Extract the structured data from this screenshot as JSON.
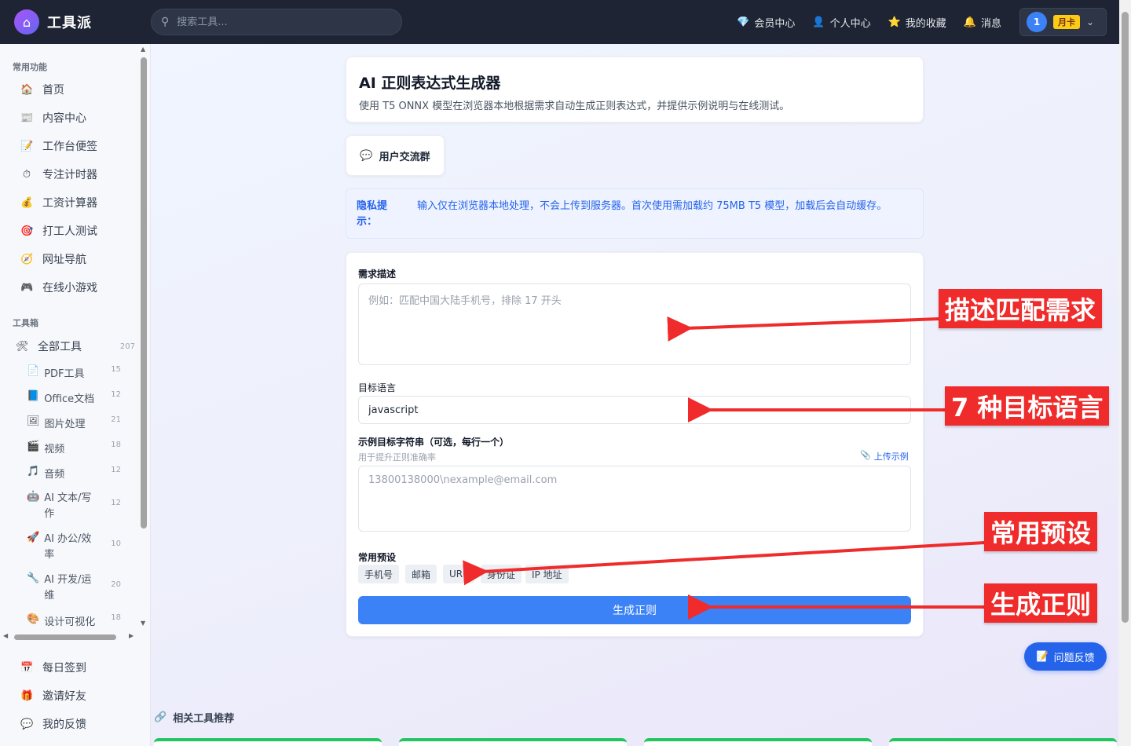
{
  "header": {
    "brand": "工具派",
    "search_placeholder": "搜索工具...",
    "nav": [
      {
        "icon": "💎",
        "label": "会员中心"
      },
      {
        "icon": "👤",
        "label": "个人中心"
      },
      {
        "icon": "⭐",
        "label": "我的收藏"
      },
      {
        "icon": "🔔",
        "label": "消息"
      }
    ],
    "user": {
      "avatar": "1",
      "badge": "月卡"
    }
  },
  "sidebar": {
    "section_common": "常用功能",
    "common": [
      {
        "icon": "🏠",
        "label": "首页"
      },
      {
        "icon": "📰",
        "label": "内容中心"
      },
      {
        "icon": "📝",
        "label": "工作台便签"
      },
      {
        "icon": "⏱",
        "label": "专注计时器"
      },
      {
        "icon": "💰",
        "label": "工资计算器"
      },
      {
        "icon": "🎯",
        "label": "打工人测试"
      },
      {
        "icon": "🧭",
        "label": "网址导航"
      },
      {
        "icon": "🎮",
        "label": "在线小游戏"
      }
    ],
    "section_tools": "工具箱",
    "all_tools": {
      "icon": "🛠",
      "label": "全部工具",
      "count": "207"
    },
    "tools": [
      {
        "icon": "📄",
        "label": "PDF工具",
        "count": "15"
      },
      {
        "icon": "📘",
        "label": "Office文档",
        "count": "12"
      },
      {
        "icon": "🖼",
        "label": "图片处理",
        "count": "21"
      },
      {
        "icon": "🎬",
        "label": "视频",
        "count": "18"
      },
      {
        "icon": "🎵",
        "label": "音频",
        "count": "12"
      },
      {
        "icon": "🤖",
        "label": "AI 文本/写作",
        "count": "12"
      },
      {
        "icon": "🚀",
        "label": "AI 办公/效率",
        "count": "10"
      },
      {
        "icon": "🔧",
        "label": "AI 开发/运维",
        "count": "20"
      },
      {
        "icon": "🎨",
        "label": "设计可视化",
        "count": "18"
      }
    ],
    "bottom": [
      {
        "icon": "📅",
        "label": "每日签到"
      },
      {
        "icon": "🎁",
        "label": "邀请好友"
      },
      {
        "icon": "💬",
        "label": "我的反馈"
      }
    ]
  },
  "main": {
    "title": "AI 正则表达式生成器",
    "subtitle": "使用 T5 ONNX 模型在浏览器本地根据需求自动生成正则表达式，并提供示例说明与在线测试。",
    "community": {
      "icon": "💬",
      "label": "用户交流群"
    },
    "privacy": {
      "label": "隐私提示：",
      "text": "输入仅在浏览器本地处理，不会上传到服务器。首次使用需加载约 75MB T5 模型，加载后会自动缓存。"
    },
    "form": {
      "desc_label": "需求描述",
      "desc_placeholder": "例如：匹配中国大陆手机号，排除 17 开头",
      "lang_label": "目标语言",
      "lang_value": "javascript",
      "examples_label": "示例目标字符串（可选，每行一个）",
      "examples_hint": "用于提升正则准确率",
      "upload_label": "上传示例",
      "examples_placeholder": "13800138000\\nexample@email.com",
      "presets_label": "常用预设",
      "presets": [
        "手机号",
        "邮箱",
        "URL",
        "身份证",
        "IP 地址"
      ],
      "generate_label": "生成正则"
    },
    "feedback": {
      "icon": "📝",
      "label": "问题反馈"
    },
    "related": {
      "icon": "🔗",
      "label": "相关工具推荐"
    }
  },
  "callouts": [
    "描述匹配需求",
    "7 种目标语言",
    "常用预设",
    "生成正则"
  ],
  "colors": {
    "primary": "#3b82f6",
    "callout": "#ef2b2b",
    "topbar": "#1e2433",
    "month_badge": "#facc15"
  }
}
